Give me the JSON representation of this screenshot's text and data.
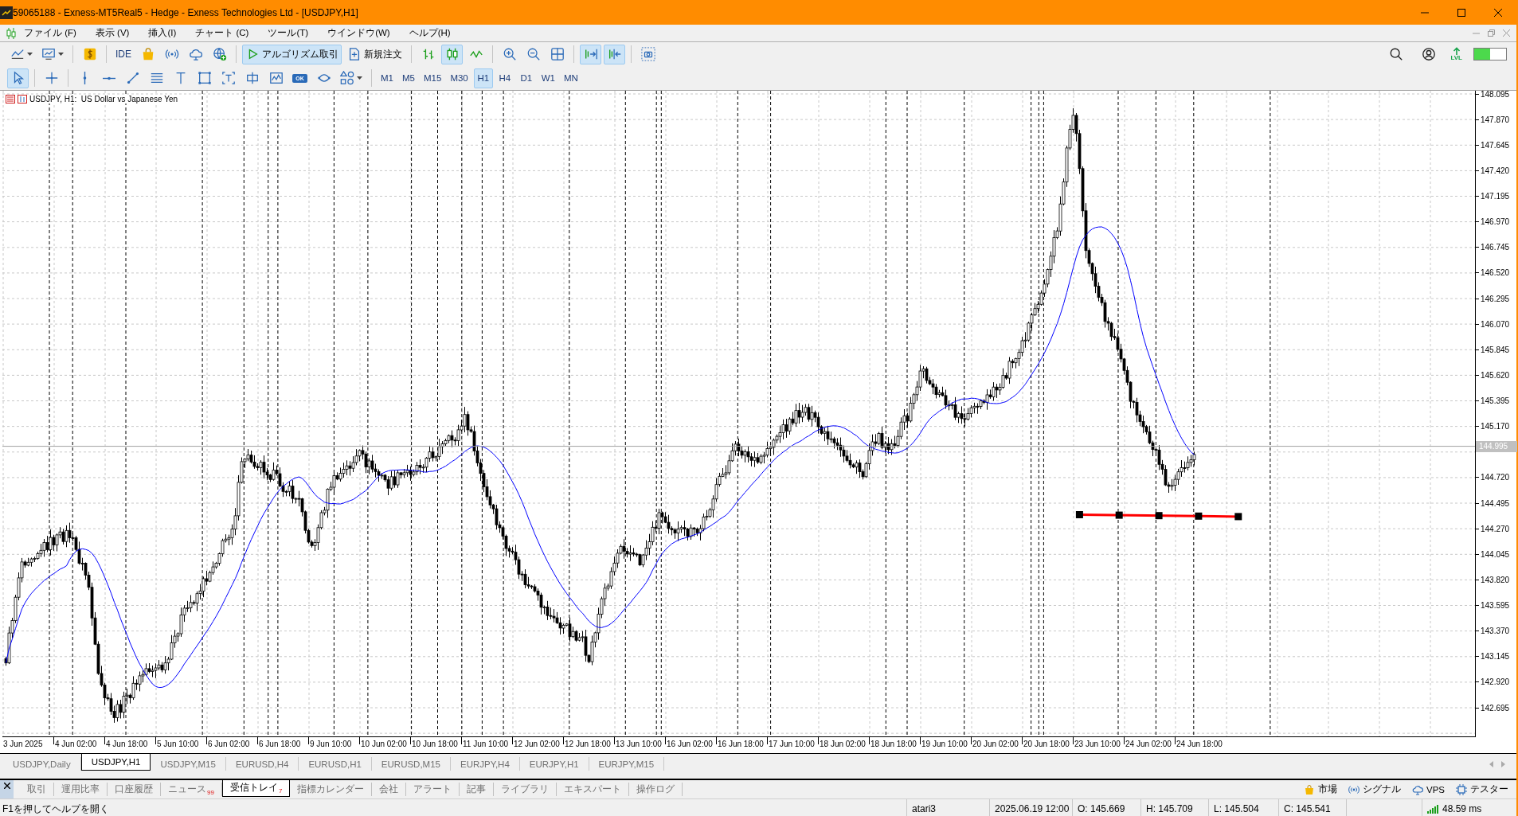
{
  "window": {
    "title": "59065188 - Exness-MT5Real5 - Hedge - Exness Technologies Ltd - [USDJPY,H1]"
  },
  "menu": [
    {
      "label": "ファイル (F)"
    },
    {
      "label": "表示 (V)"
    },
    {
      "label": "挿入(I)"
    },
    {
      "label": "チャート (C)"
    },
    {
      "label": "ツール(T)"
    },
    {
      "label": "ウインドウ(W)"
    },
    {
      "label": "ヘルプ(H)"
    }
  ],
  "toolbar": {
    "ide_label": "IDE",
    "algo_trading": {
      "label": "アルゴリズム取引",
      "on": true
    },
    "new_order": {
      "label": "新規注文"
    },
    "chart_types": [
      {
        "selected": false
      },
      {
        "selected": true
      },
      {
        "selected": false
      }
    ],
    "autoscroll": {
      "on": true
    },
    "chart_shift": {
      "on": true
    },
    "lvl_label": "LVL",
    "level_meter": {
      "level": 0.5
    }
  },
  "drawing_tools": [
    {
      "selected": true
    },
    {
      "selected": false
    },
    {
      "selected": false
    },
    {
      "selected": false
    },
    {
      "selected": false
    },
    {
      "selected": false
    },
    {
      "selected": false
    },
    {
      "selected": false
    },
    {
      "selected": false
    },
    {
      "selected": false
    },
    {
      "selected": false
    },
    {
      "selected": false,
      "label": "OK"
    },
    {
      "selected": false
    },
    {
      "selected": false
    }
  ],
  "timeframes": [
    {
      "label": "M1",
      "selected": false
    },
    {
      "label": "M5",
      "selected": false
    },
    {
      "label": "M15",
      "selected": false
    },
    {
      "label": "M30",
      "selected": false
    },
    {
      "label": "H1",
      "selected": true
    },
    {
      "label": "H4",
      "selected": false
    },
    {
      "label": "D1",
      "selected": false
    },
    {
      "label": "W1",
      "selected": false
    },
    {
      "label": "MN",
      "selected": false
    }
  ],
  "chart": {
    "header": "USDJPY, H1:  US Dollar vs Japanese Yen",
    "price_labels": [
      "148.095",
      "147.870",
      "147.645",
      "147.420",
      "147.195",
      "146.970",
      "146.745",
      "146.520",
      "146.295",
      "146.070",
      "145.845",
      "145.620",
      "145.395",
      "145.170",
      "144.720",
      "144.495",
      "144.270",
      "144.045",
      "143.820",
      "143.595",
      "143.370",
      "143.145",
      "142.920",
      "142.695"
    ],
    "current_price": "144.995",
    "time_labels": [
      "3 Jun 2025",
      "4 Jun 02:00",
      "4 Jun 18:00",
      "5 Jun 10:00",
      "6 Jun 02:00",
      "6 Jun 18:00",
      "9 Jun 10:00",
      "10 Jun 02:00",
      "10 Jun 18:00",
      "11 Jun 10:00",
      "12 Jun 02:00",
      "12 Jun 18:00",
      "13 Jun 10:00",
      "16 Jun 02:00",
      "16 Jun 18:00",
      "17 Jun 10:00",
      "18 Jun 02:00",
      "18 Jun 18:00",
      "19 Jun 10:00",
      "20 Jun 02:00",
      "20 Jun 18:00",
      "23 Jun 10:00",
      "24 Jun 02:00",
      "24 Jun 18:00"
    ]
  },
  "chart_tabs": [
    {
      "label": "USDJPY,Daily",
      "selected": false
    },
    {
      "label": "USDJPY,H1",
      "selected": true
    },
    {
      "label": "USDJPY,M15",
      "selected": false
    },
    {
      "label": "EURUSD,H4",
      "selected": false
    },
    {
      "label": "EURUSD,H1",
      "selected": false
    },
    {
      "label": "EURUSD,M15",
      "selected": false
    },
    {
      "label": "EURJPY,H4",
      "selected": false
    },
    {
      "label": "EURJPY,H1",
      "selected": false
    },
    {
      "label": "EURJPY,M15",
      "selected": false
    }
  ],
  "toolbox_tabs": [
    {
      "label": "取引",
      "selected": false
    },
    {
      "label": "運用比率",
      "selected": false
    },
    {
      "label": "口座履歴",
      "selected": false
    },
    {
      "label": "ニュース",
      "badge": "99",
      "selected": false
    },
    {
      "label": "受信トレイ",
      "badge": "7",
      "selected": true
    },
    {
      "label": "指標カレンダー",
      "selected": false
    },
    {
      "label": "会社",
      "selected": false
    },
    {
      "label": "アラート",
      "selected": false
    },
    {
      "label": "記事",
      "selected": false
    },
    {
      "label": "ライブラリ",
      "selected": false
    },
    {
      "label": "エキスパート",
      "selected": false
    },
    {
      "label": "操作ログ",
      "selected": false
    }
  ],
  "toolbox_links": [
    {
      "label": "市場"
    },
    {
      "label": "シグナル"
    },
    {
      "label": "VPS"
    },
    {
      "label": "テスター"
    }
  ],
  "status_bar": {
    "help": "F1を押してヘルプを開く",
    "profile": "atari3",
    "time": "2025.06.19 12:00",
    "open": "O: 145.669",
    "high": "H: 145.709",
    "low": "L: 145.504",
    "close": "C: 145.541",
    "ping": "48.59 ms"
  }
}
